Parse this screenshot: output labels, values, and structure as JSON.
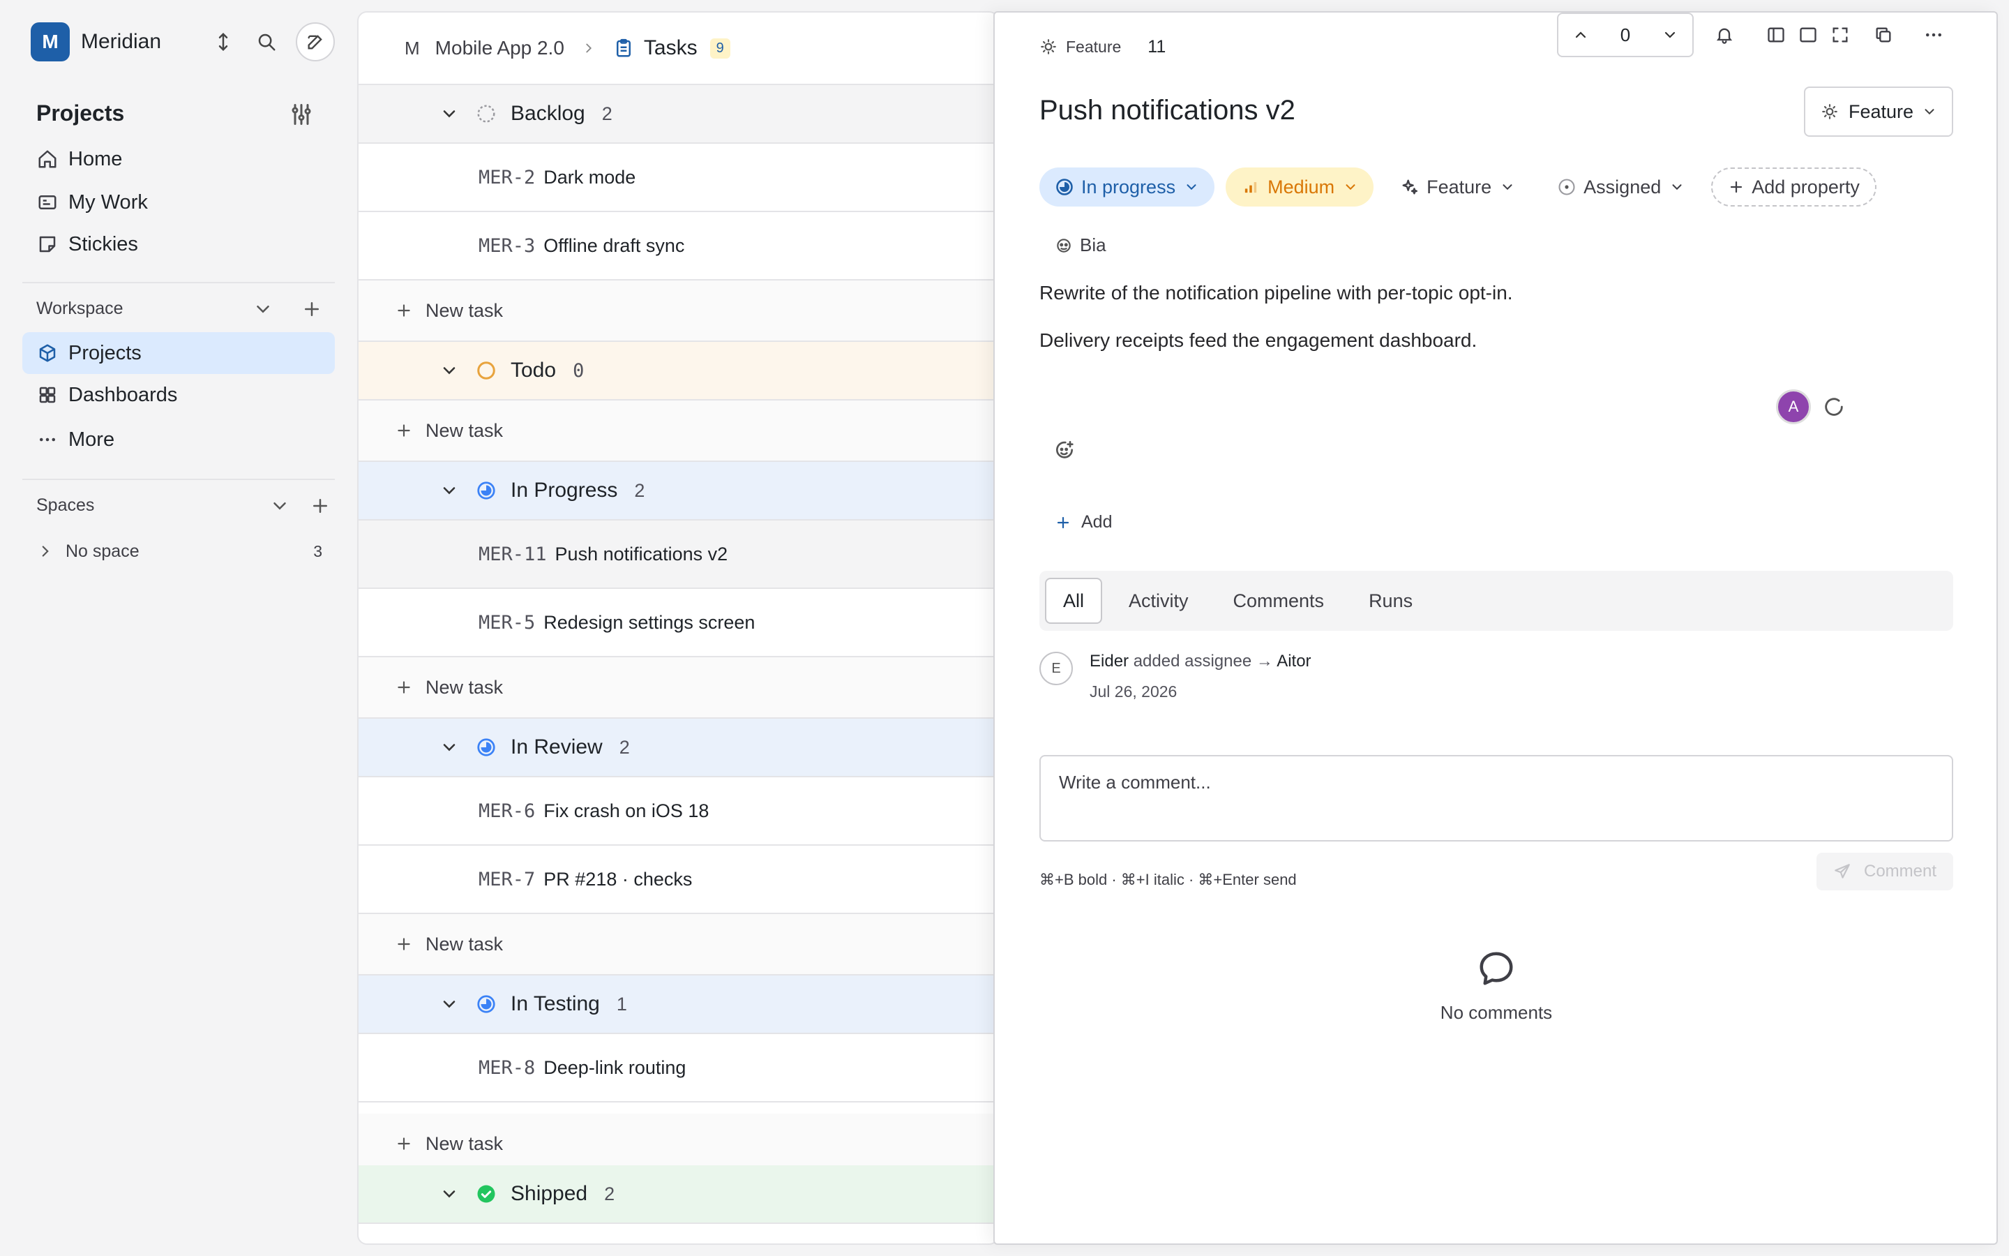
{
  "workspace": {
    "initial": "M",
    "name": "Meridian"
  },
  "sidebar": {
    "section_title": "Projects",
    "nav": [
      {
        "label": "Home",
        "icon": "home-icon"
      },
      {
        "label": "My Work",
        "icon": "work-icon"
      },
      {
        "label": "Stickies",
        "icon": "sticky-icon"
      }
    ],
    "workspace_label": "Workspace",
    "workspace_items": [
      {
        "label": "Projects",
        "icon": "cube-icon",
        "active": true
      },
      {
        "label": "Dashboards",
        "icon": "grid-icon",
        "active": false
      },
      {
        "label": "More",
        "icon": "more-icon",
        "active": false
      }
    ],
    "spaces_label": "Spaces",
    "spaces": [
      {
        "label": "No space",
        "count": "3"
      }
    ]
  },
  "breadcrumb": {
    "project_initial": "M",
    "project": "Mobile App 2.0",
    "page": "Tasks",
    "badge": "9"
  },
  "groups": [
    {
      "name": "Backlog",
      "count": "2",
      "status": "backlog",
      "tasks": [
        {
          "key": "MER-2",
          "title": "Dark mode"
        },
        {
          "key": "MER-3",
          "title": "Offline draft sync"
        }
      ]
    },
    {
      "name": "Todo",
      "count": "0",
      "status": "todo",
      "tasks": []
    },
    {
      "name": "In Progress",
      "count": "2",
      "status": "progress",
      "tasks": [
        {
          "key": "MER-11",
          "title": "Push notifications v2",
          "selected": true
        },
        {
          "key": "MER-5",
          "title": "Redesign settings screen"
        }
      ]
    },
    {
      "name": "In Review",
      "count": "2",
      "status": "progress",
      "tasks": [
        {
          "key": "MER-6",
          "title": "Fix crash on iOS 18"
        },
        {
          "key": "MER-7",
          "title": "PR #218 · checks"
        }
      ]
    },
    {
      "name": "In Testing",
      "count": "1",
      "status": "progress",
      "tasks": [
        {
          "key": "MER-8",
          "title": "Deep-link routing"
        }
      ]
    },
    {
      "name": "Shipped",
      "count": "2",
      "status": "shipped",
      "tasks": []
    }
  ],
  "new_task_label": "New task",
  "detail": {
    "type_label": "Feature",
    "number": "11",
    "stepper_value": "0",
    "title": "Push notifications v2",
    "type_button": "Feature",
    "status": "In progress",
    "priority": "Medium",
    "type_prop": "Feature",
    "assigned": "Assigned",
    "add_property": "Add property",
    "assignee": "Bia",
    "description": [
      "Rewrite of the notification pipeline with per-topic opt-in.",
      "Delivery receipts feed the engagement dashboard."
    ],
    "avatar_initial": "A",
    "add_label": "Add",
    "tabs": [
      "All",
      "Activity",
      "Comments",
      "Runs"
    ],
    "activity": {
      "initial": "E",
      "actor": "Eider",
      "action": "added assignee →",
      "target": "Aitor",
      "date": "Jul 26, 2026"
    },
    "comment_placeholder": "Write a comment...",
    "shortcut_hint": "⌘+B bold · ⌘+I italic · ⌘+Enter send",
    "comment_button": "Comment",
    "empty_label": "No comments"
  },
  "colors": {
    "accent": "#1e5fa8",
    "priority": "#d97706",
    "success": "#22c55e",
    "todo": "#e8a33d"
  }
}
